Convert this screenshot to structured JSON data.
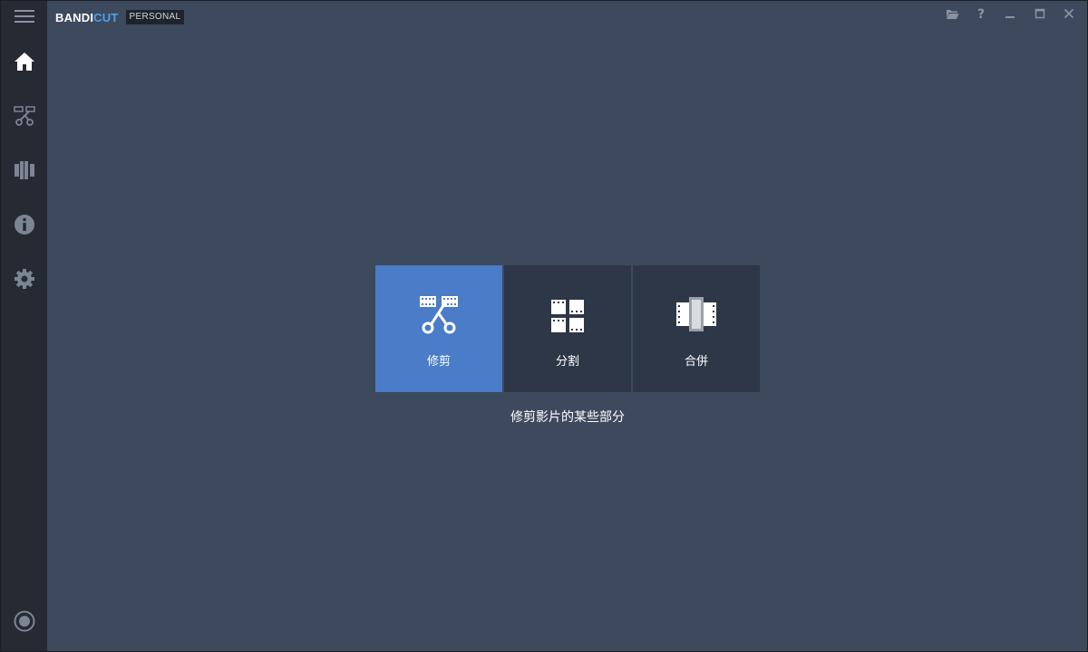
{
  "app": {
    "brand_main": "BANDI",
    "brand_accent": "CUT",
    "edition": "PERSONAL"
  },
  "colors": {
    "accent": "#4a7cc7",
    "brand_accent": "#4aa3f2",
    "background": "#3d4a5d",
    "sidebar": "#252a33",
    "tile": "#2e3747"
  },
  "sidebar": {
    "items": [
      {
        "icon": "menu-icon",
        "active": false
      },
      {
        "icon": "home-icon",
        "active": true
      },
      {
        "icon": "trim-icon",
        "active": false
      },
      {
        "icon": "join-icon",
        "active": false
      },
      {
        "icon": "info-icon",
        "active": false
      },
      {
        "icon": "settings-icon",
        "active": false
      },
      {
        "icon": "record-icon",
        "active": false
      }
    ]
  },
  "window_controls": [
    "folder-icon",
    "help-icon",
    "minimize-icon",
    "maximize-icon",
    "close-icon"
  ],
  "main": {
    "tiles": [
      {
        "label": "修剪",
        "icon": "trim-scissors-icon",
        "selected": true
      },
      {
        "label": "分割",
        "icon": "split-icon",
        "selected": false
      },
      {
        "label": "合併",
        "icon": "merge-icon",
        "selected": false
      }
    ],
    "description": "修剪影片的某些部分"
  }
}
